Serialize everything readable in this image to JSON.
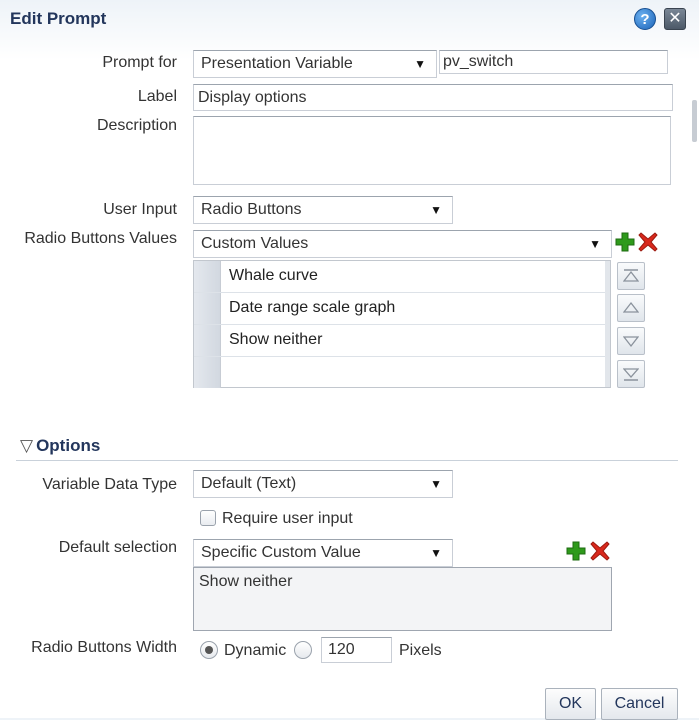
{
  "dialog": {
    "title": "Edit Prompt",
    "help_glyph": "?",
    "close_glyph": "✕"
  },
  "form": {
    "prompt_for": {
      "label": "Prompt for",
      "value": "Presentation Variable",
      "variable_name": "pv_switch"
    },
    "label_field": {
      "label": "Label",
      "value": "Display options"
    },
    "description": {
      "label": "Description",
      "value": ""
    },
    "user_input": {
      "label": "User Input",
      "value": "Radio Buttons"
    },
    "radio_values": {
      "label": "Radio Buttons Values",
      "source": "Custom Values",
      "items": [
        "Whale curve",
        "Date range scale graph",
        "Show neither",
        ""
      ]
    }
  },
  "options": {
    "header": "Options",
    "variable_data_type": {
      "label": "Variable Data Type",
      "value": "Default (Text)"
    },
    "require_user_input": {
      "label": "Require user input",
      "checked": false
    },
    "default_selection": {
      "label": "Default selection",
      "value": "Specific Custom Value",
      "selected_text": "Show neither"
    },
    "radio_width": {
      "label": "Radio Buttons Width",
      "dynamic_label": "Dynamic",
      "pixels_value": "120",
      "pixels_label": "Pixels",
      "selected": "Dynamic"
    }
  },
  "buttons": {
    "ok": "OK",
    "cancel": "Cancel"
  },
  "icons": {
    "dropdown_arrow": "▼",
    "collapse_triangle": "▽",
    "add": "add-icon",
    "delete": "delete-icon",
    "move_top": "move-top-icon",
    "move_up": "move-up-icon",
    "move_down": "move-down-icon",
    "move_bottom": "move-bottom-icon"
  },
  "colors": {
    "title": "#23365c",
    "add_green": "#2e9a1b",
    "delete_red": "#d9281c"
  }
}
